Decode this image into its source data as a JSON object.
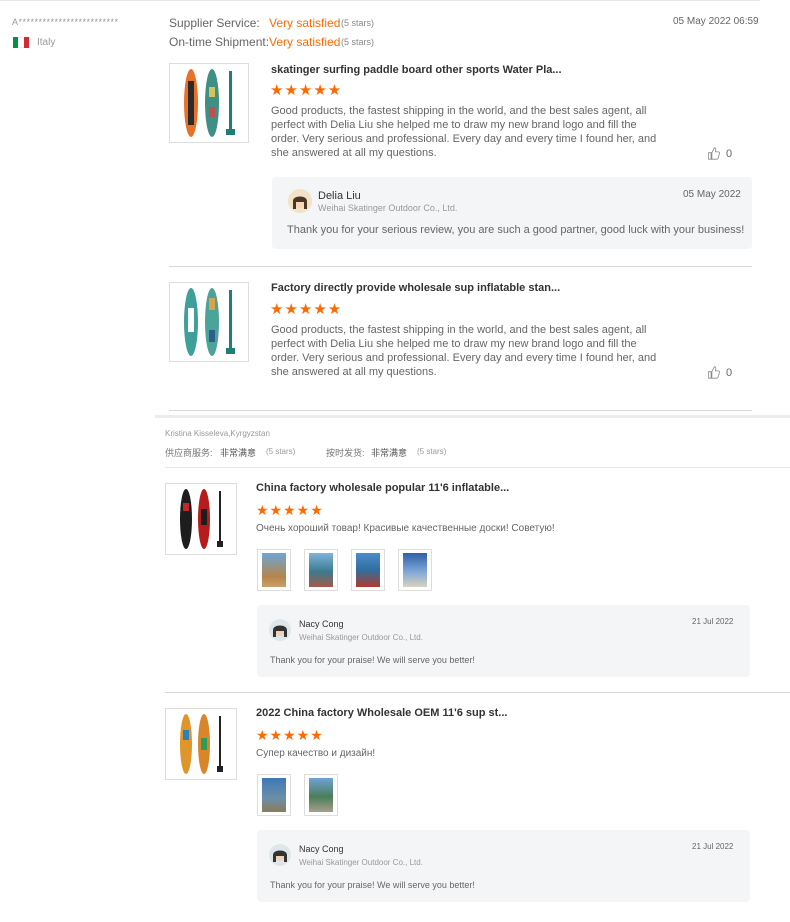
{
  "review1": {
    "reviewer": "A*************************",
    "country": "Italy",
    "supplier_service_label": "Supplier Service:",
    "supplier_service_value": "Very satisfied",
    "supplier_service_stars": "(5 stars)",
    "ontime_label": "On-time Shipment:",
    "ontime_value": "Very satisfied",
    "ontime_stars": "(5 stars)",
    "date": "05 May 2022 06:59",
    "items": [
      {
        "title": "skatinger surfing paddle board other sports Water Pla...",
        "stars": "★★★★★",
        "text": "Good products,  the fastest shipping in the world, and the best sales agent, all perfect with Delia Liu she helped me to draw my new brand logo and fill the order. Very serious and professional. Every day and every time I found her, and she answered at all my questions.",
        "likes": "0",
        "reply": {
          "name": "Delia Liu",
          "company": "Weihai Skatinger Outdoor Co., Ltd.",
          "date": "05 May 2022",
          "text": "Thank you for your serious review, you are such a good partner, good luck with your business!"
        }
      },
      {
        "title": "Factory directly provide wholesale sup inflatable stan...",
        "stars": "★★★★★",
        "text": "Good products,  the fastest shipping in the world, and the best sales agent, all perfect with Delia Liu she helped me to draw my new brand logo and fill the order. Very serious and professional. Every day and every time I found her, and she answered at all my questions.",
        "likes": "0"
      }
    ]
  },
  "review2": {
    "reviewer": "Kristina Kisseleva,Kyrgyzstan",
    "supplier_label": "供应商服务:",
    "supplier_value": "非常满意",
    "supplier_stars": "(5 stars)",
    "ontime_label": "按时发货:",
    "ontime_value": "非常满意",
    "ontime_stars": "(5 stars)",
    "items": [
      {
        "title": "China factory wholesale popular 11'6 inflatable...",
        "stars": "★★★★★",
        "text": "Очень хороший товар! Красивые качественные доски! Советую!",
        "reply": {
          "name": "Nacy Cong",
          "company": "Weihai Skatinger Outdoor Co., Ltd.",
          "date": "21 Jul 2022",
          "text": "Thank you for your praise! We will serve you better!"
        }
      },
      {
        "title": "2022 China factory Wholesale OEM 11'6 sup st...",
        "stars": "★★★★★",
        "text": "Супер качество и дизайн!",
        "reply": {
          "name": "Nacy Cong",
          "company": "Weihai Skatinger Outdoor Co., Ltd.",
          "date": "21 Jul 2022",
          "text": "Thank you for your praise! We will serve you better!"
        }
      }
    ]
  },
  "colors": {
    "accent": "#ff6a00",
    "flag_green": "#009246",
    "flag_white": "#ffffff",
    "flag_red": "#ce2b37"
  },
  "icons": {
    "like": "thumbs-up-icon"
  }
}
